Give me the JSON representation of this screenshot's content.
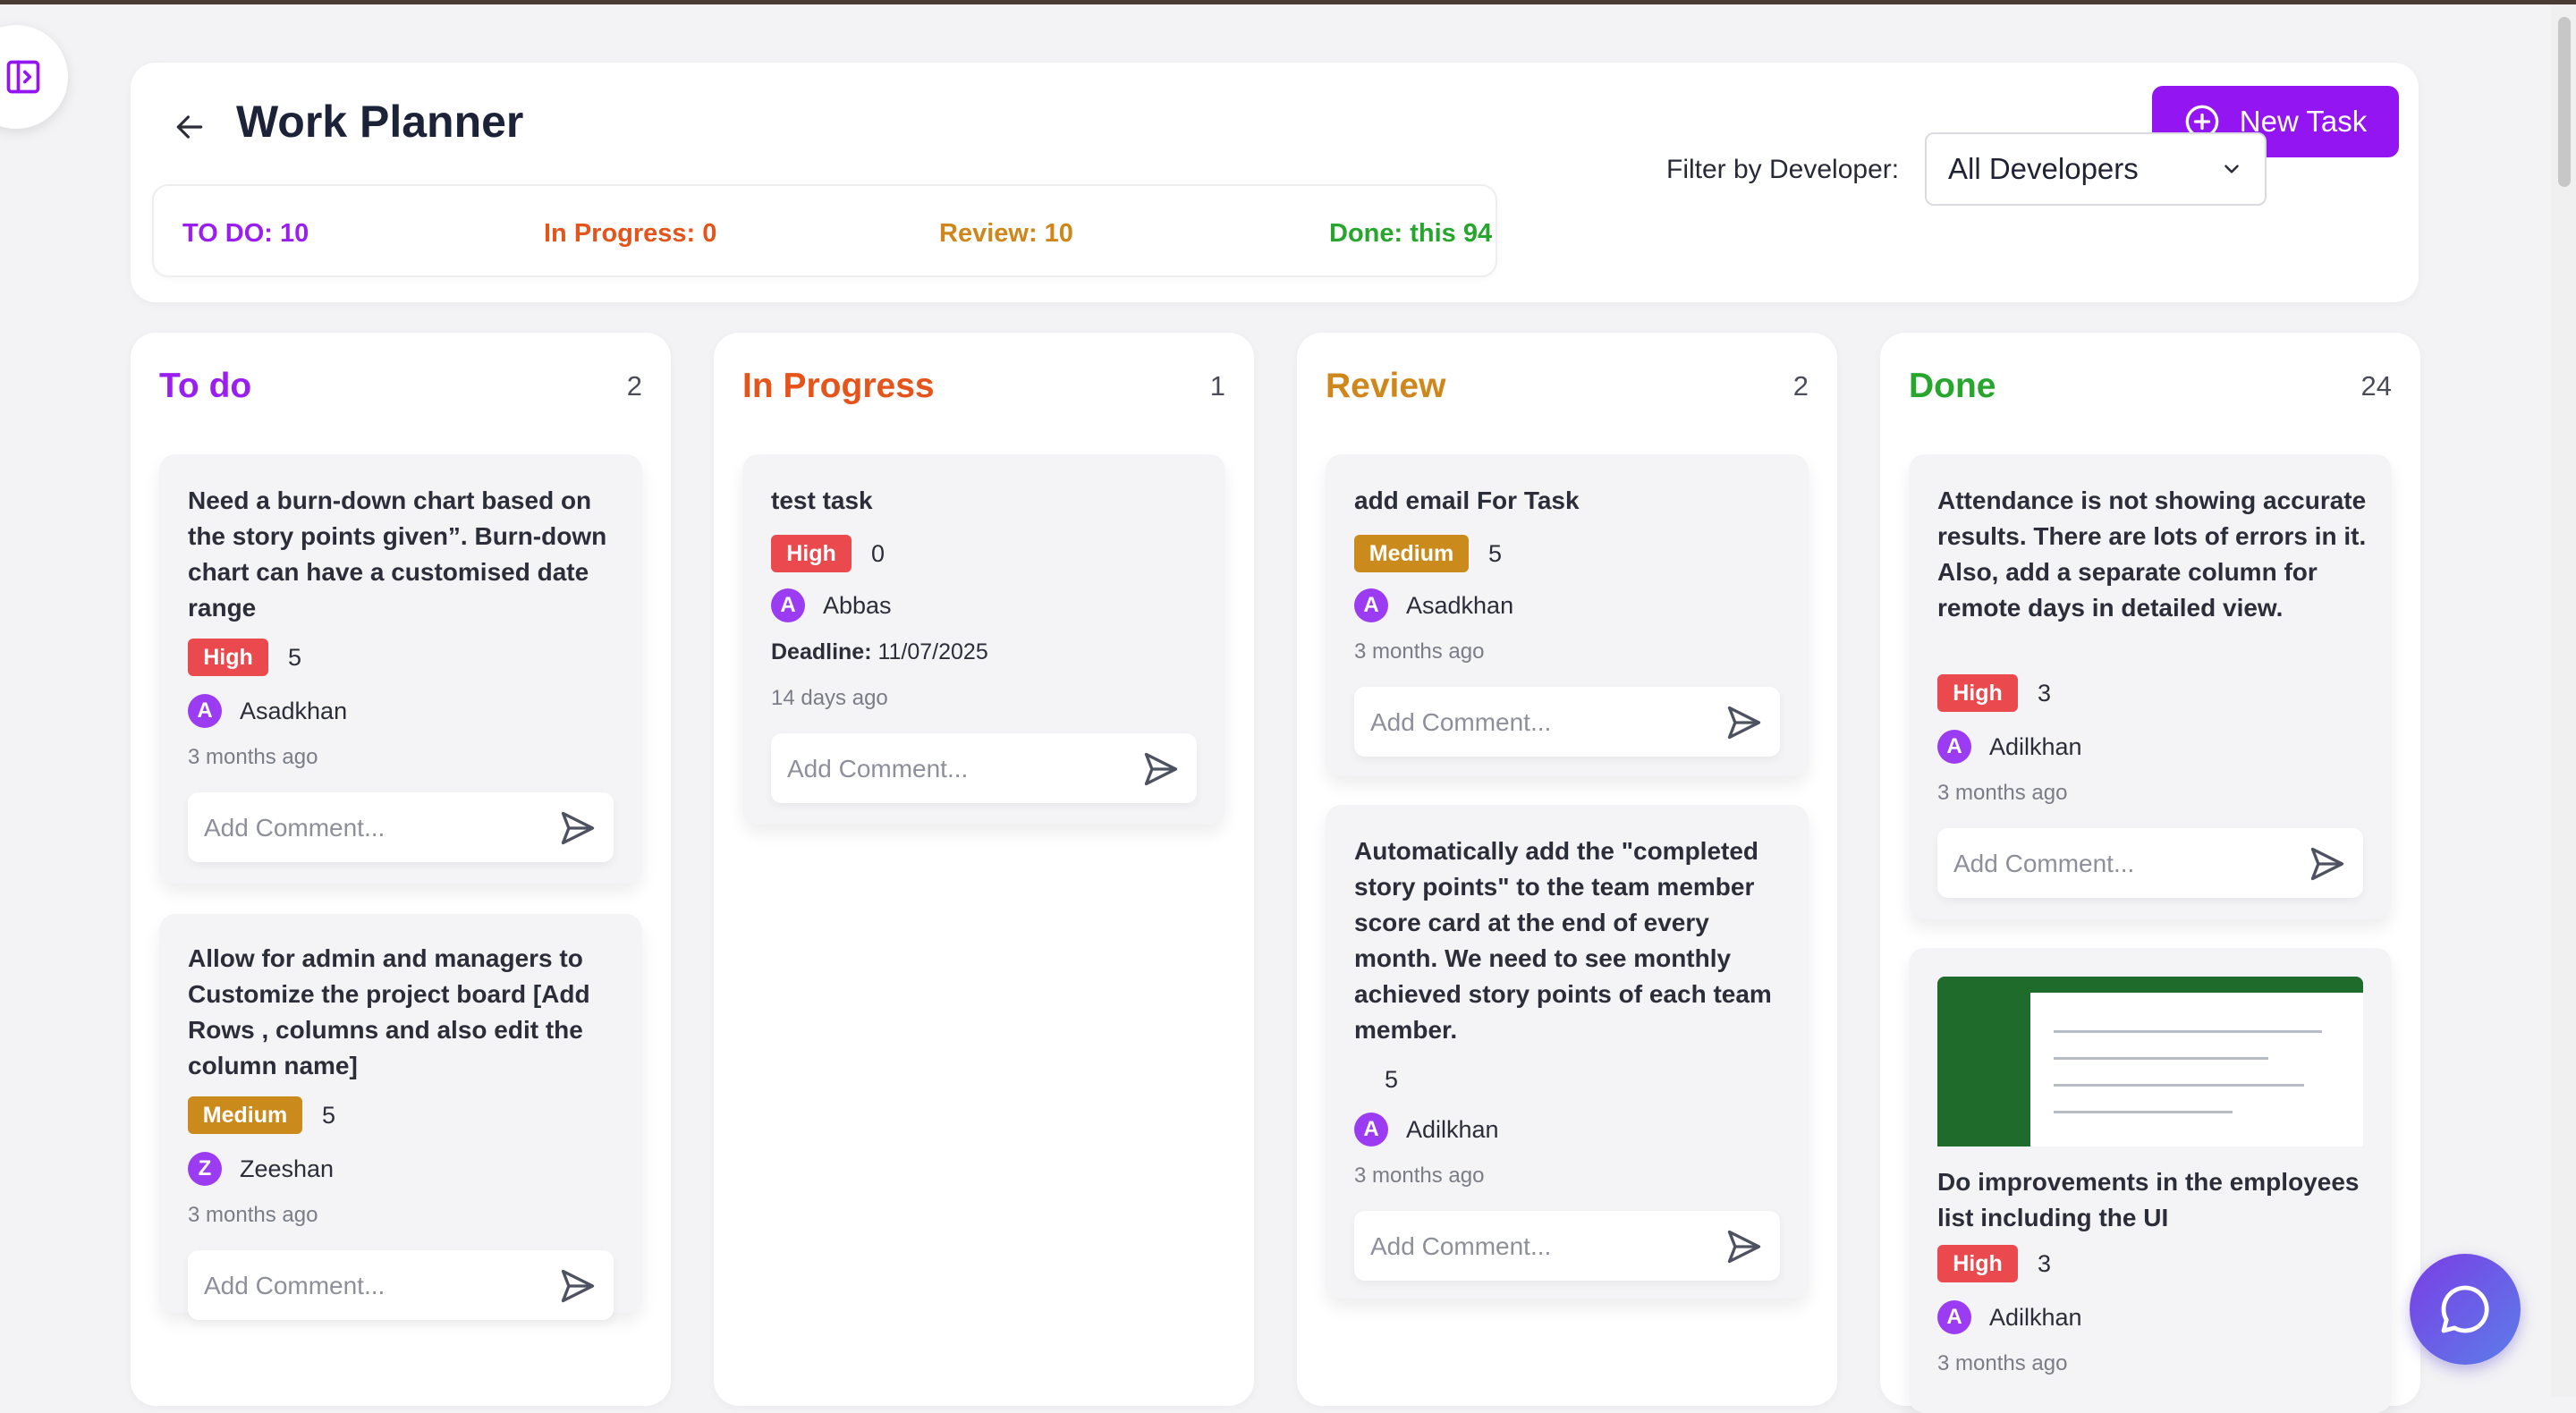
{
  "header": {
    "title": "Work Planner",
    "new_task_label": "New Task",
    "filter_label": "Filter by Developer:",
    "filter_value": "All Developers"
  },
  "stats": {
    "todo": "TO DO: 10",
    "in_progress": "In Progress: 0",
    "review": "Review: 10",
    "done": "Done: this 94"
  },
  "colors": {
    "todo": "#9a1ef0",
    "in_progress": "#e4541b",
    "review": "#cf861a",
    "done": "#26a62c",
    "primary": "#9215f2",
    "high": "#ea4a4d",
    "medium": "#cb8a1c"
  },
  "comment_placeholder": "Add Comment...",
  "columns": [
    {
      "title": "To do",
      "count": "2",
      "cards": [
        {
          "title": "Need a burn-down chart based on the story points given”. Burn-down chart can have a customised date range",
          "priority": "High",
          "points": "5",
          "avatar_letter": "A",
          "assignee": "Asadkhan",
          "time_ago": "3 months ago"
        },
        {
          "title": "Allow for admin and managers to Customize the project board [Add Rows , columns and also edit the column name]",
          "priority": "Medium",
          "points": "5",
          "avatar_letter": "Z",
          "assignee": "Zeeshan",
          "time_ago": "3 months ago"
        }
      ]
    },
    {
      "title": "In Progress",
      "count": "1",
      "cards": [
        {
          "title": "test task",
          "priority": "High",
          "points": "0",
          "avatar_letter": "A",
          "assignee": "Abbas",
          "deadline_label": "Deadline:",
          "deadline_value": " 11/07/2025",
          "time_ago": "14 days ago"
        }
      ]
    },
    {
      "title": "Review",
      "count": "2",
      "cards": [
        {
          "title": "add email For Task",
          "priority": "Medium",
          "points": "5",
          "avatar_letter": "A",
          "assignee": "Asadkhan",
          "time_ago": "3 months ago"
        },
        {
          "title": "Automatically add the \"completed story points\" to the team member score card at the end of every month. We need to see monthly achieved story points of each team member.",
          "points": "5",
          "avatar_letter": "A",
          "assignee": "Adilkhan",
          "time_ago": "3 months ago"
        }
      ]
    },
    {
      "title": "Done",
      "count": "24",
      "cards": [
        {
          "title": "Attendance is not showing accurate results. There are lots of errors in it. Also, add a separate column for remote days in detailed view.",
          "priority": "High",
          "points": "3",
          "avatar_letter": "A",
          "assignee": "Adilkhan",
          "time_ago": "3 months ago"
        },
        {
          "title": "Do improvements in the employees list including the UI",
          "priority": "High",
          "points": "3",
          "avatar_letter": "A",
          "assignee": "Adilkhan",
          "time_ago": "3 months ago"
        }
      ]
    }
  ]
}
